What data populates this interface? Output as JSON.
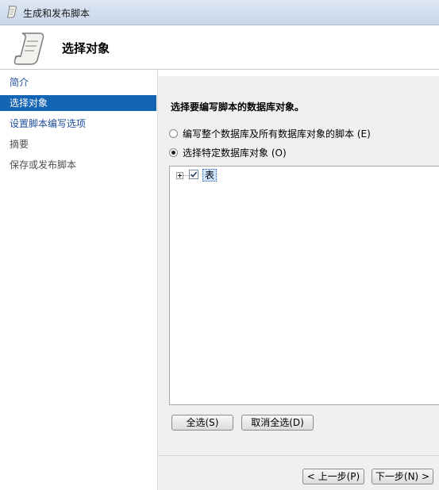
{
  "window": {
    "title": "生成和发布脚本",
    "icon": "script-scroll-icon"
  },
  "header": {
    "page_title": "选择对象",
    "icon": "script-scroll-icon"
  },
  "nav": {
    "items": [
      {
        "label": "简介",
        "state": "link"
      },
      {
        "label": "选择对象",
        "state": "selected"
      },
      {
        "label": "设置脚本编写选项",
        "state": "link"
      },
      {
        "label": "摘要",
        "state": "disabled"
      },
      {
        "label": "保存或发布脚本",
        "state": "disabled"
      }
    ]
  },
  "main": {
    "instruction": "选择要编写脚本的数据库对象。",
    "options": [
      {
        "label": "编写整个数据库及所有数据库对象的脚本 (E)",
        "checked": false
      },
      {
        "label": "选择特定数据库对象 (O)",
        "checked": true
      }
    ],
    "tree": {
      "root_label": "表",
      "checked": true,
      "expanded": false
    },
    "select_all_label": "全选(S)",
    "deselect_all_label": "取消全选(D)"
  },
  "footer": {
    "prev_label": "< 上一步(P)",
    "next_label": "下一步(N) >"
  },
  "colors": {
    "selection": "#1464b4",
    "link": "#1f4e9c"
  }
}
